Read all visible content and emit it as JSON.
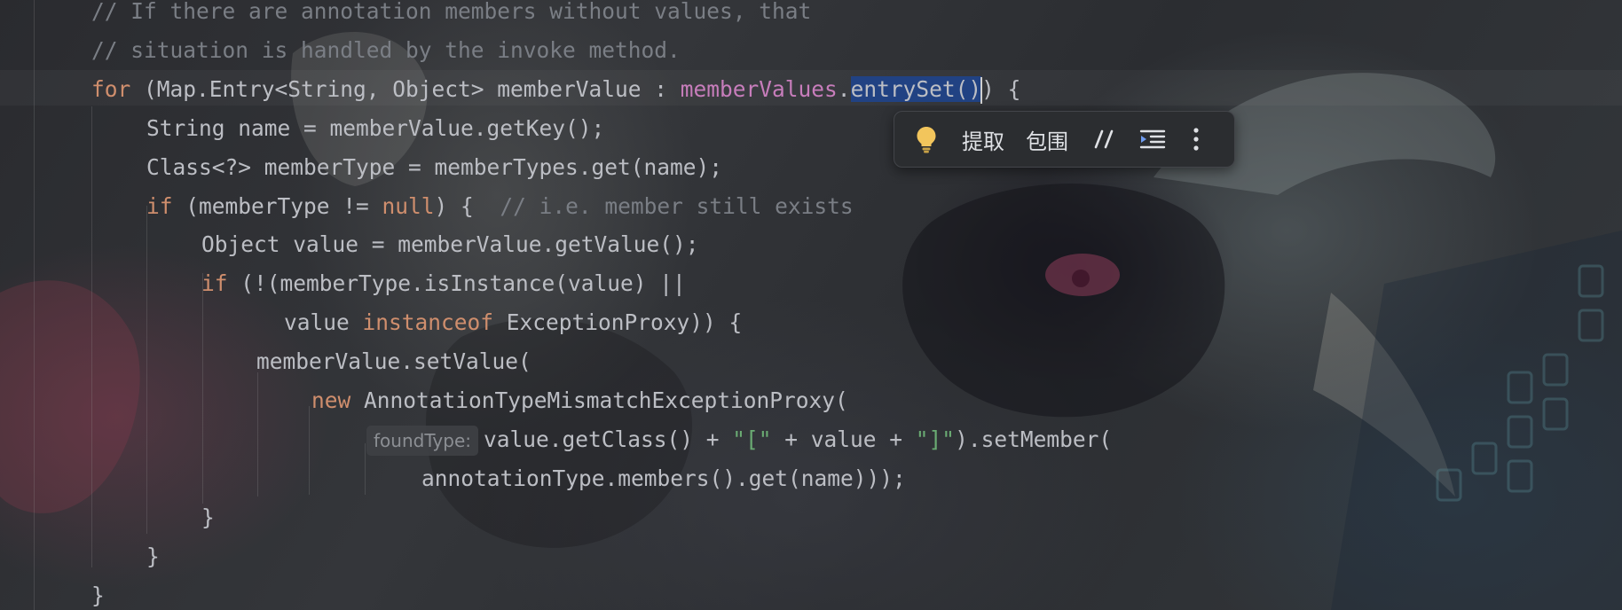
{
  "editor": {
    "lines": [
      {
        "indent": 0,
        "parts": [
          {
            "cls": "cm",
            "text": "// If there are annotation members without values, that"
          }
        ]
      },
      {
        "indent": 0,
        "parts": [
          {
            "cls": "cm",
            "text": "// situation is handled by the invoke method."
          }
        ]
      },
      {
        "indent": 0,
        "parts": [
          {
            "cls": "kw",
            "text": "for"
          },
          {
            "cls": "",
            "text": " (Map.Entry<String, Object> memberValue : "
          },
          {
            "cls": "fd",
            "text": "memberValues"
          },
          {
            "cls": "",
            "text": "."
          },
          {
            "cls": "sel",
            "text": "entrySet()"
          },
          {
            "cls": "caret",
            "text": ""
          },
          {
            "cls": "",
            "text": ") {"
          }
        ]
      },
      {
        "indent": 1,
        "parts": [
          {
            "cls": "",
            "text": "String name = memberValue.getKey();"
          }
        ]
      },
      {
        "indent": 1,
        "parts": [
          {
            "cls": "",
            "text": "Class<?> memberType = memberTypes.get(name);"
          }
        ]
      },
      {
        "indent": 1,
        "parts": [
          {
            "cls": "kw",
            "text": "if"
          },
          {
            "cls": "",
            "text": " (memberType != "
          },
          {
            "cls": "kw",
            "text": "null"
          },
          {
            "cls": "",
            "text": ") {  "
          },
          {
            "cls": "cm",
            "text": "// i.e. member still exists"
          }
        ]
      },
      {
        "indent": 2,
        "parts": [
          {
            "cls": "",
            "text": "Object value = memberValue.getValue();"
          }
        ]
      },
      {
        "indent": 2,
        "parts": [
          {
            "cls": "kw",
            "text": "if"
          },
          {
            "cls": "",
            "text": " (!(memberType.isInstance(value) ||"
          }
        ]
      },
      {
        "indent": 3.5,
        "parts": [
          {
            "cls": "",
            "text": "value "
          },
          {
            "cls": "kw",
            "text": "instanceof"
          },
          {
            "cls": "",
            "text": " ExceptionProxy)) {"
          }
        ]
      },
      {
        "indent": 3,
        "parts": [
          {
            "cls": "",
            "text": "memberValue.setValue("
          }
        ]
      },
      {
        "indent": 4,
        "parts": [
          {
            "cls": "kw",
            "text": "new"
          },
          {
            "cls": "",
            "text": " AnnotationTypeMismatchExceptionProxy("
          }
        ]
      },
      {
        "indent": 5,
        "parts": [
          {
            "cls": "hint",
            "text": "foundType:"
          },
          {
            "cls": "",
            "text": "value.getClass() + "
          },
          {
            "cls": "st",
            "text": "\"[\""
          },
          {
            "cls": "",
            "text": " + value + "
          },
          {
            "cls": "st",
            "text": "\"]\""
          },
          {
            "cls": "",
            "text": ").setMember("
          }
        ]
      },
      {
        "indent": 6,
        "parts": [
          {
            "cls": "",
            "text": "annotationType.members().get(name)));"
          }
        ]
      },
      {
        "indent": 2,
        "parts": [
          {
            "cls": "",
            "text": "}"
          }
        ]
      },
      {
        "indent": 1,
        "parts": [
          {
            "cls": "",
            "text": "}"
          }
        ]
      },
      {
        "indent": 0,
        "parts": [
          {
            "cls": "",
            "text": "}"
          }
        ]
      }
    ]
  },
  "floating_toolbar": {
    "extract_label": "提取",
    "surround_label": "包围",
    "icons": {
      "intention": "lightbulb-icon",
      "comment": "comment-icon",
      "reformat": "reformat-icon",
      "more": "more-vertical-icon"
    },
    "colors": {
      "bulb": "#f2c55c",
      "reformat": "#6f9cf0"
    }
  },
  "colors": {
    "keyword": "#cf8e6d",
    "comment": "#7a7e85",
    "field": "#c77dbb",
    "string": "#6aab73",
    "text": "#bcbec4",
    "selection": "#214283"
  }
}
